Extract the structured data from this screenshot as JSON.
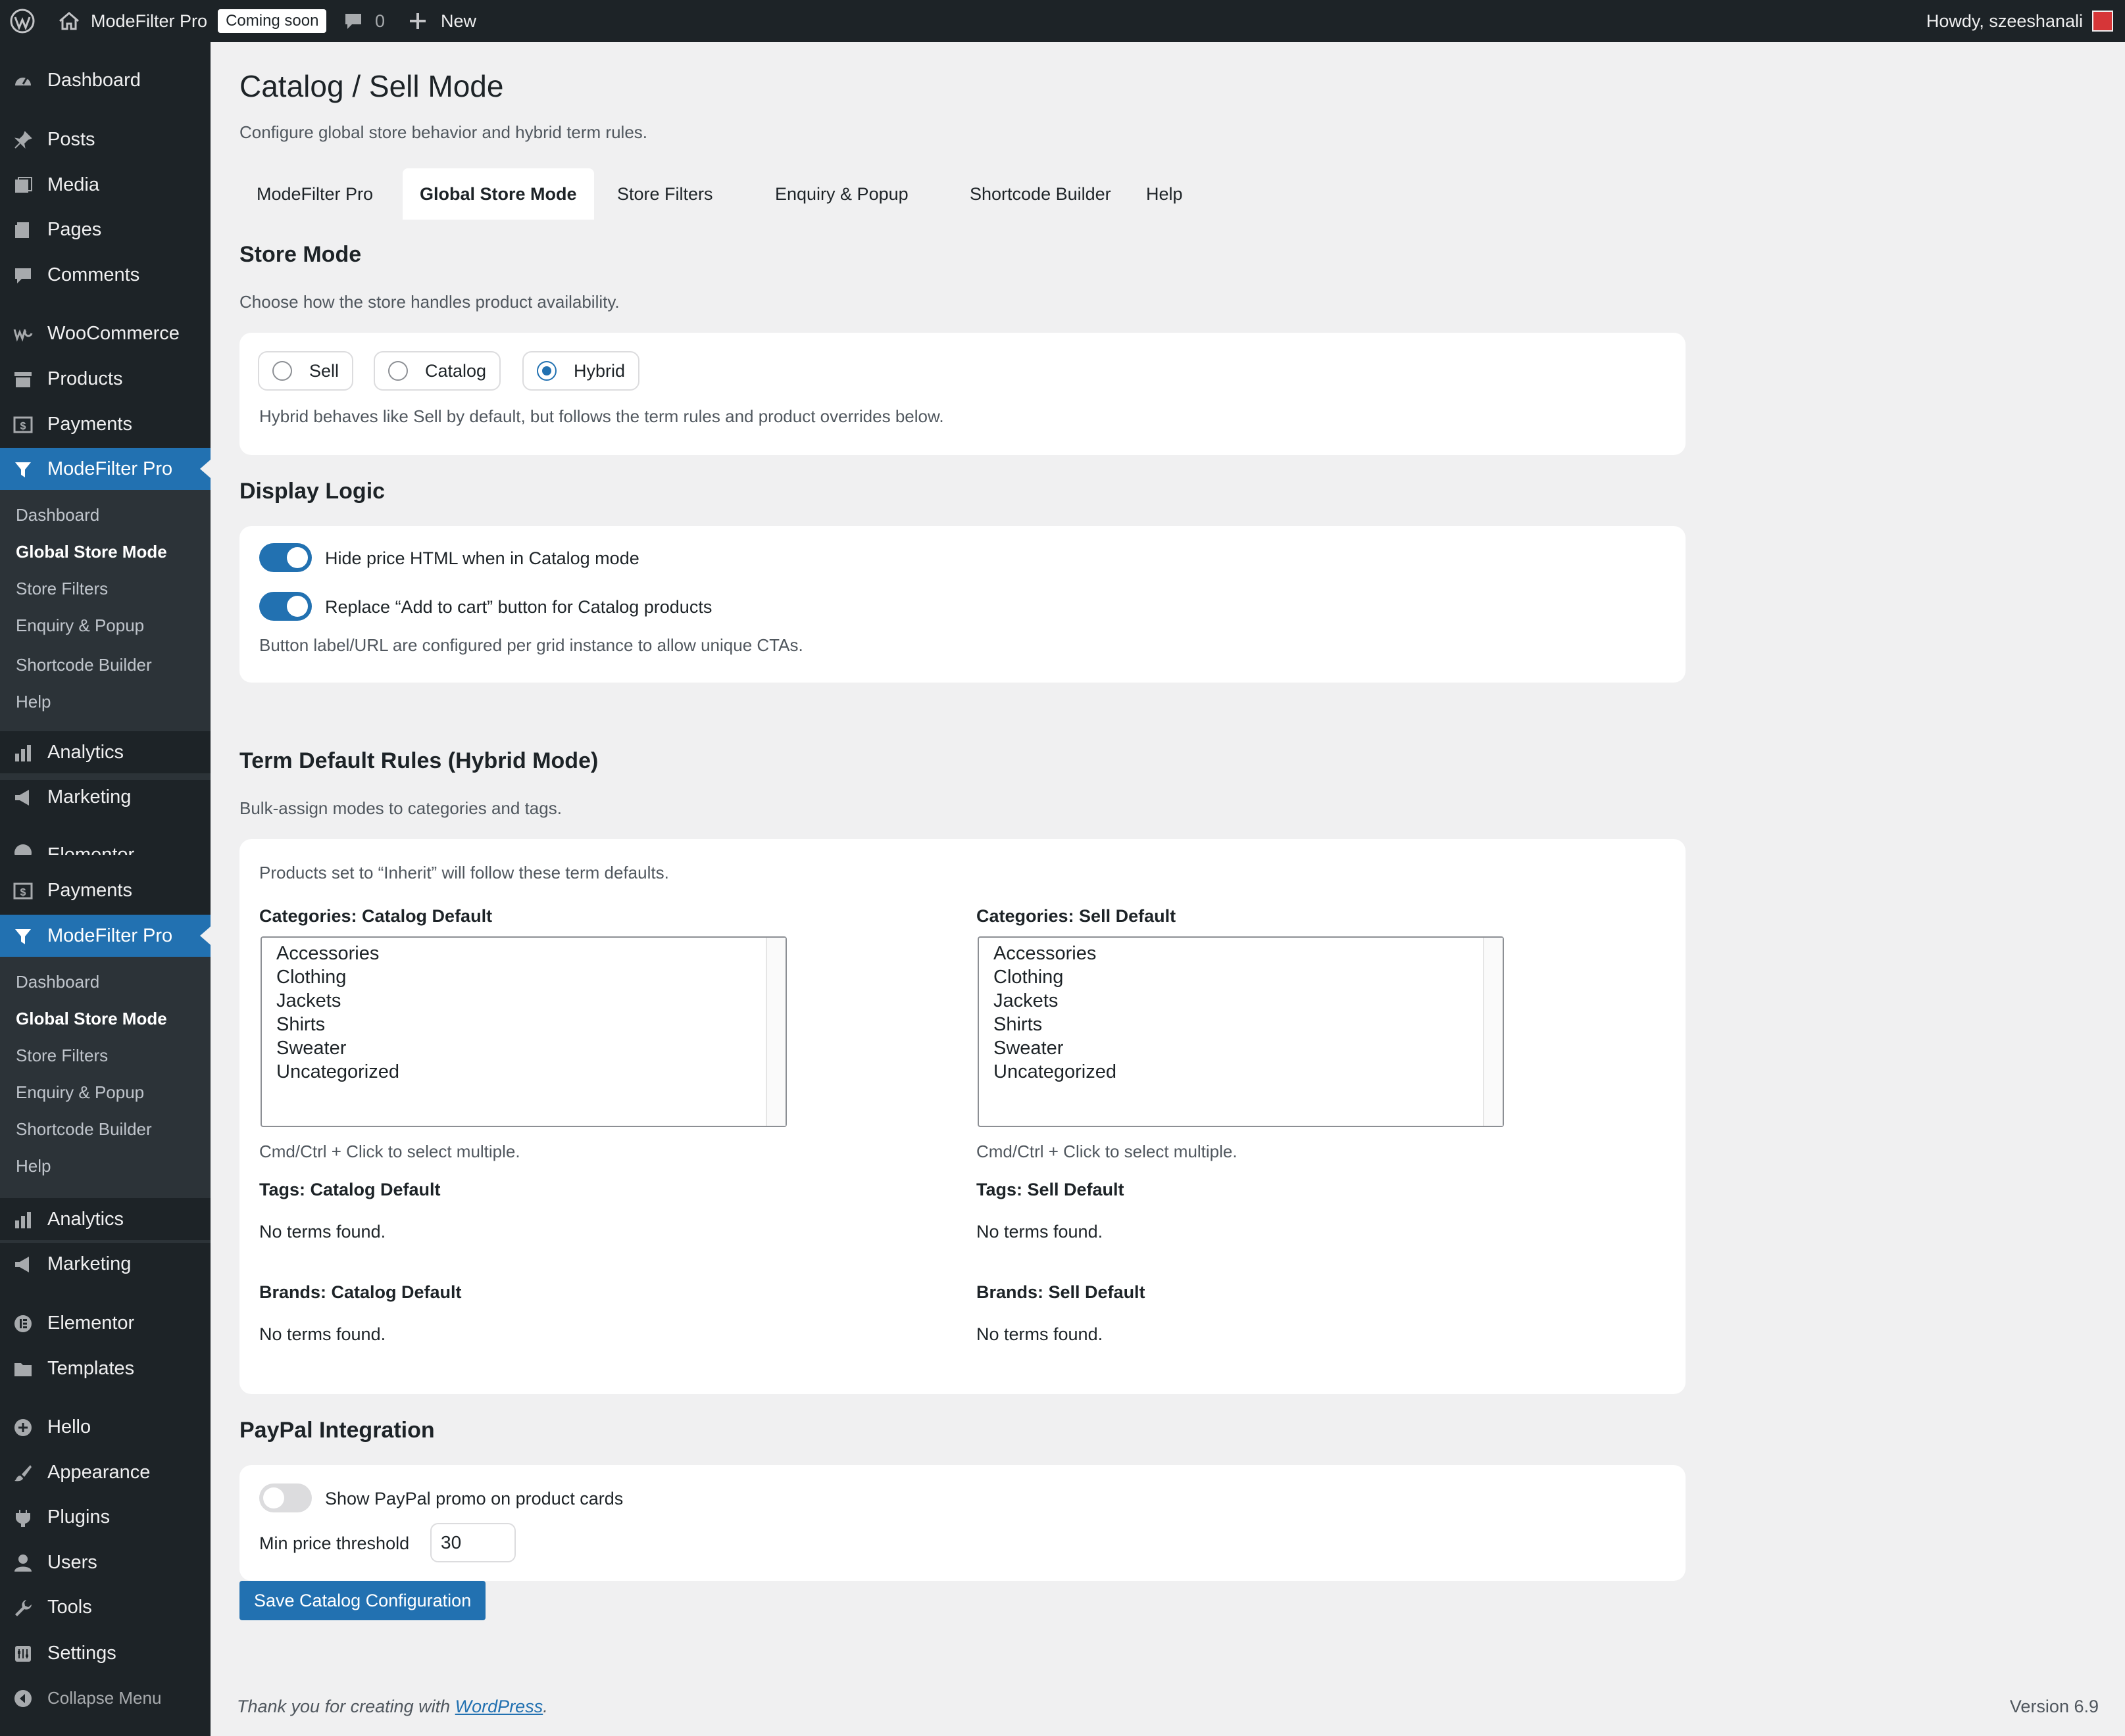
{
  "adminbar": {
    "site_name": "ModeFilter Pro",
    "coming_soon": "Coming soon",
    "comments_count": "0",
    "new_label": "New",
    "howdy": "Howdy, szeeshanali"
  },
  "menu": {
    "items": [
      {
        "label": "Dashboard",
        "icon": "dashboard-icon"
      },
      {
        "label": "Posts",
        "icon": "pin-icon"
      },
      {
        "label": "Media",
        "icon": "media-icon"
      },
      {
        "label": "Pages",
        "icon": "pages-icon"
      },
      {
        "label": "Comments",
        "icon": "comment-icon"
      },
      {
        "label": "WooCommerce",
        "icon": "woo-icon"
      },
      {
        "label": "Products",
        "icon": "archive-icon"
      },
      {
        "label": "Payments",
        "icon": "dollar-icon"
      },
      {
        "label": "ModeFilter Pro",
        "icon": "filter-icon"
      },
      {
        "label": "Analytics",
        "icon": "bar-chart-icon"
      },
      {
        "label": "Marketing",
        "icon": "megaphone-icon"
      },
      {
        "label": "Elementor",
        "icon": "elementor-icon"
      },
      {
        "label": "Payments",
        "icon": "dollar-icon"
      },
      {
        "label": "ModeFilter Pro",
        "icon": "filter-icon"
      },
      {
        "label": "Analytics",
        "icon": "bar-chart-icon"
      },
      {
        "label": "Marketing",
        "icon": "megaphone-icon"
      },
      {
        "label": "Elementor",
        "icon": "elementor-icon"
      },
      {
        "label": "Templates",
        "icon": "folder-icon"
      },
      {
        "label": "Hello",
        "icon": "plus-circle-icon"
      },
      {
        "label": "Appearance",
        "icon": "brush-icon"
      },
      {
        "label": "Plugins",
        "icon": "plug-icon"
      },
      {
        "label": "Users",
        "icon": "user-icon"
      },
      {
        "label": "Tools",
        "icon": "wrench-icon"
      },
      {
        "label": "Settings",
        "icon": "settings-icon"
      },
      {
        "label": "Collapse Menu",
        "icon": "collapse-icon"
      }
    ],
    "submenu": [
      "Dashboard",
      "Global Store Mode",
      "Store Filters",
      "Enquiry & Popup",
      "Shortcode Builder",
      "Help"
    ]
  },
  "page": {
    "title": "Catalog / Sell Mode",
    "description": "Configure global store behavior and hybrid term rules."
  },
  "tabs": [
    "ModeFilter Pro",
    "Global Store Mode",
    "Store Filters",
    "Enquiry & Popup",
    "Shortcode Builder",
    "Help"
  ],
  "store_mode": {
    "heading": "Store Mode",
    "description": "Choose how the store handles product availability.",
    "options": [
      "Sell",
      "Catalog",
      "Hybrid"
    ],
    "selected": "Hybrid",
    "note": "Hybrid behaves like Sell by default, but follows the term rules and product overrides below."
  },
  "display_logic": {
    "heading": "Display Logic",
    "hide_price": {
      "label": "Hide price HTML when in Catalog mode",
      "on": true
    },
    "replace_cart": {
      "label": "Replace “Add to cart” button for Catalog products",
      "on": true
    },
    "note": "Button label/URL are configured per grid instance to allow unique CTAs."
  },
  "term_rules": {
    "heading": "Term Default Rules (Hybrid Mode)",
    "description": "Bulk-assign modes to categories and tags.",
    "note": "Products set to “Inherit” will follow these term defaults.",
    "cat_catalog_label": "Categories: Catalog Default",
    "cat_sell_label": "Categories: Sell Default",
    "categories": [
      "Accessories",
      "Clothing",
      "Jackets",
      "Shirts",
      "Sweater",
      "Uncategorized"
    ],
    "hint": "Cmd/Ctrl + Click to select multiple.",
    "tags_catalog_label": "Tags: Catalog Default",
    "tags_sell_label": "Tags: Sell Default",
    "brands_catalog_label": "Brands: Catalog Default",
    "brands_sell_label": "Brands: Sell Default",
    "no_terms": "No terms found."
  },
  "paypal": {
    "heading": "PayPal Integration",
    "promo_label": "Show PayPal promo on product cards",
    "promo_on": false,
    "threshold_label": "Min price threshold",
    "threshold_value": "30"
  },
  "save_button": "Save Catalog Configuration",
  "footer": {
    "text": "Thank you for creating with ",
    "link": "WordPress",
    "suffix": ".",
    "version": "Version 6.9"
  },
  "colors": {
    "accent": "#2271b1",
    "menu_bg": "#1d2327",
    "submenu_bg": "#2c3338",
    "page_bg": "#f0f0f1"
  }
}
